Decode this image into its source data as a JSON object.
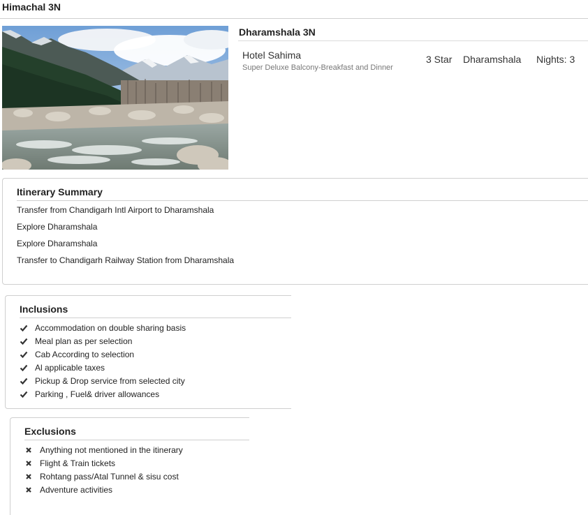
{
  "package": {
    "title": "Himachal 3N"
  },
  "hero": {
    "icon": "landscape-river-image"
  },
  "hotel": {
    "city_title": "Dharamshala 3N",
    "name": "Hotel Sahima",
    "room": "Super Deluxe Balcony-Breakfast and Dinner",
    "star": "3 Star",
    "city": "Dharamshala",
    "nights": "Nights: 3"
  },
  "itinerary": {
    "heading": "Itinerary Summary",
    "items": [
      "Transfer from Chandigarh Intl Airport to Dharamshala",
      "Explore Dharamshala",
      "Explore Dharamshala",
      "Transfer to Chandigarh Railway Station from Dharamshala"
    ]
  },
  "inclusions": {
    "heading": "Inclusions",
    "icon": "check-icon",
    "items": [
      "Accommodation on double sharing basis",
      "Meal plan as per selection",
      "Cab According to selection",
      "Al applicable taxes",
      "Pickup & Drop service from selected city",
      "Parking , Fuel& driver allowances"
    ]
  },
  "exclusions": {
    "heading": "Exclusions",
    "icon": "cross-icon",
    "items": [
      "Anything not mentioned in the itinerary",
      "Flight & Train tickets",
      "Rohtang pass/Atal Tunnel & sisu cost",
      "Adventure activities"
    ]
  }
}
